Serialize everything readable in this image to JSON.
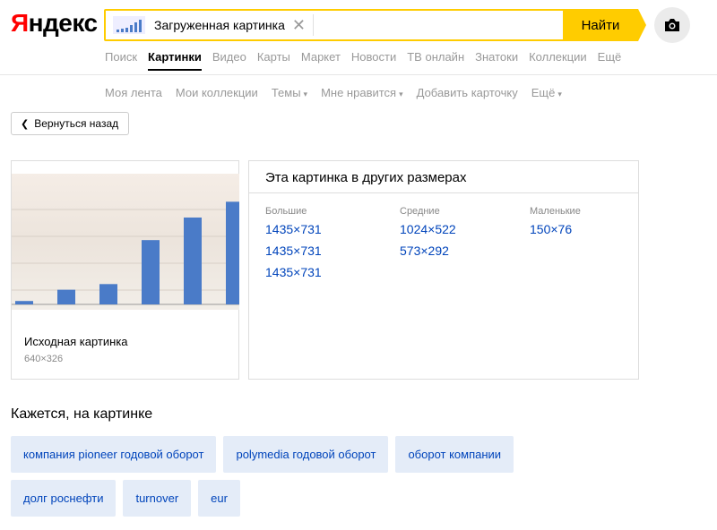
{
  "header": {
    "logo_first": "Я",
    "logo_rest": "ндекс",
    "search_value": "Загруженная картинка",
    "find_label": "Найти",
    "camera_icon": "camera-icon",
    "accent": "#ffcc00"
  },
  "services": [
    {
      "label": "Поиск",
      "active": false
    },
    {
      "label": "Картинки",
      "active": true
    },
    {
      "label": "Видео",
      "active": false
    },
    {
      "label": "Карты",
      "active": false
    },
    {
      "label": "Маркет",
      "active": false
    },
    {
      "label": "Новости",
      "active": false
    },
    {
      "label": "ТВ онлайн",
      "active": false
    },
    {
      "label": "Знатоки",
      "active": false
    },
    {
      "label": "Коллекции",
      "active": false
    },
    {
      "label": "Ещё",
      "active": false
    }
  ],
  "subnav": [
    "Моя лента",
    "Мои коллекции",
    "Темы",
    "Мне нравится",
    "Добавить карточку",
    "Ещё"
  ],
  "back_label": "Вернуться назад",
  "original": {
    "title": "Исходная картинка",
    "size": "640×326"
  },
  "sizes": {
    "title": "Эта картинка в других размерах",
    "large_label": "Большие",
    "large": [
      "1435×731",
      "1435×731",
      "1435×731"
    ],
    "medium_label": "Средние",
    "medium": [
      "1024×522",
      "573×292"
    ],
    "small_label": "Маленькие",
    "small": [
      "150×76"
    ]
  },
  "tags_title": "Кажется, на картинке",
  "tags": [
    "компания pioneer годовой оборот",
    "polymedia годовой оборот",
    "оборот компании",
    "долг роснефти",
    "turnover",
    "eur"
  ],
  "chart_data": {
    "type": "bar",
    "values": [
      3,
      13,
      18,
      57,
      77,
      91
    ],
    "ylim": [
      0,
      100
    ]
  }
}
